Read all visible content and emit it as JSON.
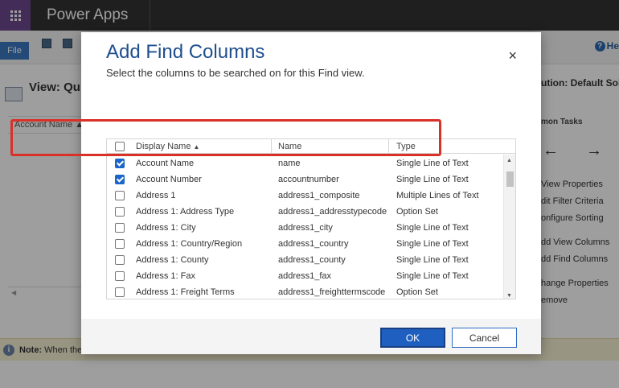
{
  "app": {
    "brand": "Power Apps"
  },
  "ribbon": {
    "file_label": "File",
    "help_label": "He",
    "help_icon": "?"
  },
  "view": {
    "title": "View: Qu",
    "grid_header": "Account Name ▲"
  },
  "right_pane": {
    "solution": "ution: Default Soluti",
    "tasks_heading": "mon Tasks",
    "back_arrow": "←",
    "forward_arrow": "→",
    "tasks": [
      "View Properties",
      "dit Filter Criteria",
      "onfigure Sorting",
      "dd View Columns",
      "dd Find Columns",
      "hange Properties",
      "emove"
    ]
  },
  "note": {
    "label": "Note:",
    "text": " When the",
    "icon": "i"
  },
  "dialog": {
    "title": "Add Find Columns",
    "subtitle": "Select the columns to be searched on for this Find view.",
    "close_glyph": "×",
    "columns": {
      "display_name": "Display Name",
      "sort_glyph": "▲",
      "name": "Name",
      "type": "Type"
    },
    "rows": [
      {
        "display": "Account Name",
        "name": "name",
        "type": "Single Line of Text",
        "checked": true
      },
      {
        "display": "Account Number",
        "name": "accountnumber",
        "type": "Single Line of Text",
        "checked": true
      },
      {
        "display": "Address 1",
        "name": "address1_composite",
        "type": "Multiple Lines of Text",
        "checked": false
      },
      {
        "display": "Address 1: Address Type",
        "name": "address1_addresstypecode",
        "type": "Option Set",
        "checked": false
      },
      {
        "display": "Address 1: City",
        "name": "address1_city",
        "type": "Single Line of Text",
        "checked": false
      },
      {
        "display": "Address 1: Country/Region",
        "name": "address1_country",
        "type": "Single Line of Text",
        "checked": false
      },
      {
        "display": "Address 1: County",
        "name": "address1_county",
        "type": "Single Line of Text",
        "checked": false
      },
      {
        "display": "Address 1: Fax",
        "name": "address1_fax",
        "type": "Single Line of Text",
        "checked": false
      },
      {
        "display": "Address 1: Freight Terms",
        "name": "address1_freighttermscode",
        "type": "Option Set",
        "checked": false
      }
    ],
    "ok_label": "OK",
    "cancel_label": "Cancel"
  },
  "colors": {
    "accent": "#1f5fbf",
    "highlight": "#d83228",
    "title": "#1f4f8f",
    "brand_tile": "#6d4a8f"
  }
}
